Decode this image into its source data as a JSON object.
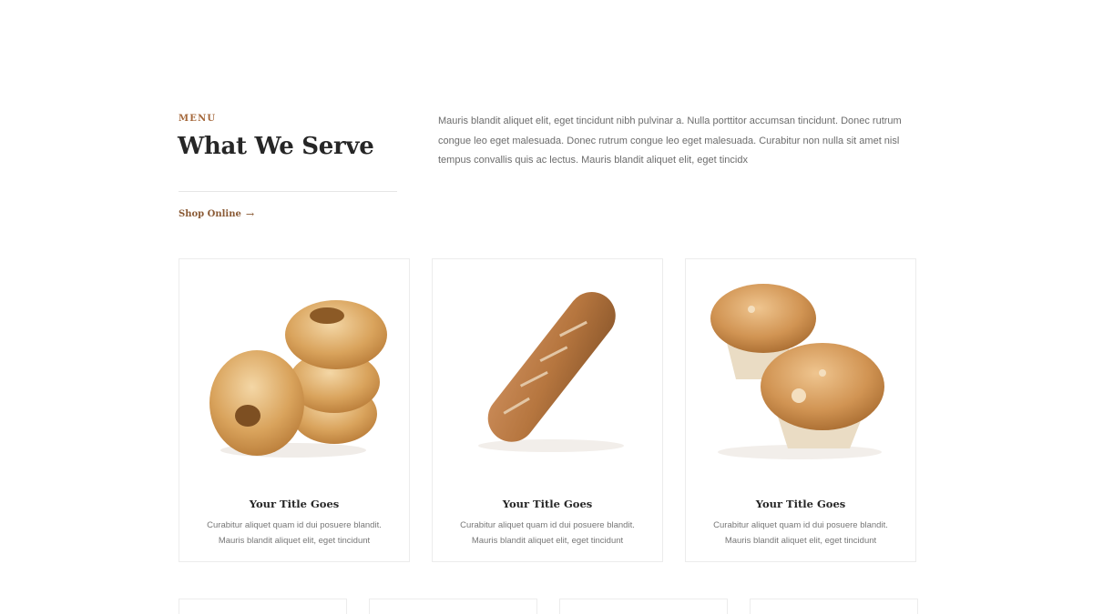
{
  "section": {
    "eyebrow": "MENU",
    "title": "What We Serve",
    "shop_label": "Shop Online",
    "shop_arrow": "→",
    "intro": "Mauris blandit aliquet elit, eget tincidunt nibh pulvinar a. Nulla porttitor accumsan tincidunt. Donec rutrum congue leo eget malesuada. Donec rutrum congue leo eget malesuada. Curabitur non nulla sit amet nisl tempus convallis quis ac lectus. Mauris blandit aliquet elit, eget tincidx"
  },
  "cards": [
    {
      "image": "bagels-image",
      "title": "Your Title Goes",
      "text": "Curabitur aliquet quam id dui posuere blandit. Mauris blandit aliquet elit, eget tincidunt"
    },
    {
      "image": "baguette-image",
      "title": "Your Title Goes",
      "text": "Curabitur aliquet quam id dui posuere blandit. Mauris blandit aliquet elit, eget tincidunt"
    },
    {
      "image": "muffins-image",
      "title": "Your Title Goes",
      "text": "Curabitur aliquet quam id dui posuere blandit. Mauris blandit aliquet elit, eget tincidunt"
    }
  ],
  "colors": {
    "accent": "#a4673a",
    "link": "#8a5a35",
    "heading": "#262626",
    "body_text": "#6c6c6c",
    "border": "#ececec"
  }
}
